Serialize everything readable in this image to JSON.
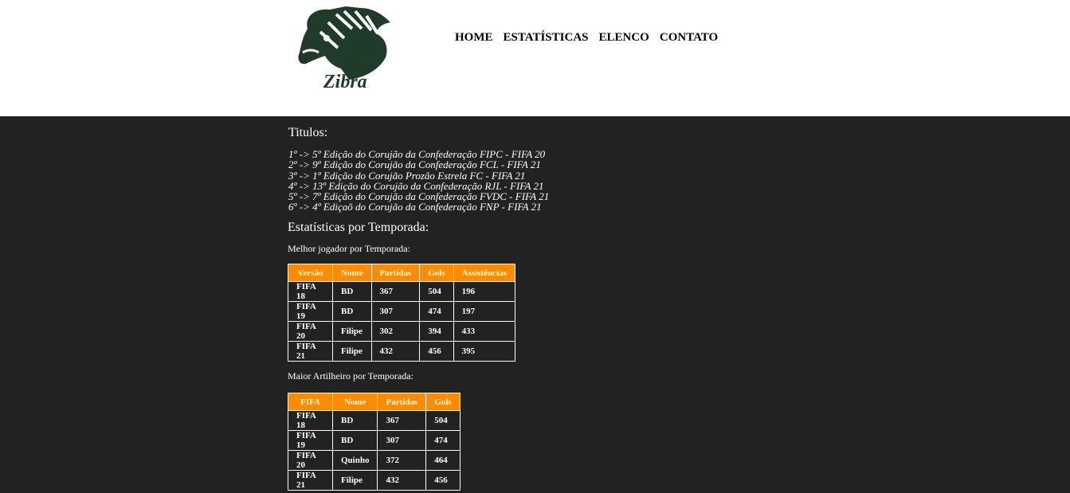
{
  "brand": {
    "logo_text": "Zibra"
  },
  "nav": [
    "HOME",
    "ESTATÍSTICAS",
    "ELENCO",
    "CONTATO"
  ],
  "titles": {
    "heading": "Titulos:",
    "items": [
      "1º -> 5º Edição do Corujão da Confederação FIPC - FIFA 20",
      "2º -> 9º Edição do Corujão da Confederação FCL - FIFA 21",
      "3º -> 1º Edição do Corujão Prozão Estrela FC - FIFA 21",
      "4º -> 13º Edição do Corujão da Confederação RJL - FIFA 21",
      "5º -> 7º Edição do Corujão da Confederação FVDC - FIFA 21",
      "6º -> 4º Ediçaõ do Corujão da Confederação FNP - FIFA 21"
    ]
  },
  "stats": {
    "heading": "Estatísticas por Temporada:",
    "best_player": {
      "label": "Melhor jogador por Temporada:",
      "columns": [
        "Versão",
        "Nome",
        "Partidas",
        "Gols",
        "Assistências"
      ],
      "rows": [
        [
          "FIFA 18",
          "BD",
          "367",
          "504",
          "196"
        ],
        [
          "FIFA 19",
          "BD",
          "307",
          "474",
          "197"
        ],
        [
          "FIFA 20",
          "Filipe",
          "302",
          "394",
          "433"
        ],
        [
          "FIFA 21",
          "Filipe",
          "432",
          "456",
          "395"
        ]
      ]
    },
    "top_scorer": {
      "label": "Maior Artilheiro por Temporada:",
      "columns": [
        "FIFA",
        "Nome",
        "Partidas",
        "Gols"
      ],
      "rows": [
        [
          "FIFA 18",
          "BD",
          "367",
          "504"
        ],
        [
          "FIFA 19",
          "BD",
          "307",
          "474"
        ],
        [
          "FIFA 20",
          "Quinho",
          "372",
          "464"
        ],
        [
          "FIFA 21",
          "Filipe",
          "432",
          "456"
        ]
      ]
    }
  }
}
